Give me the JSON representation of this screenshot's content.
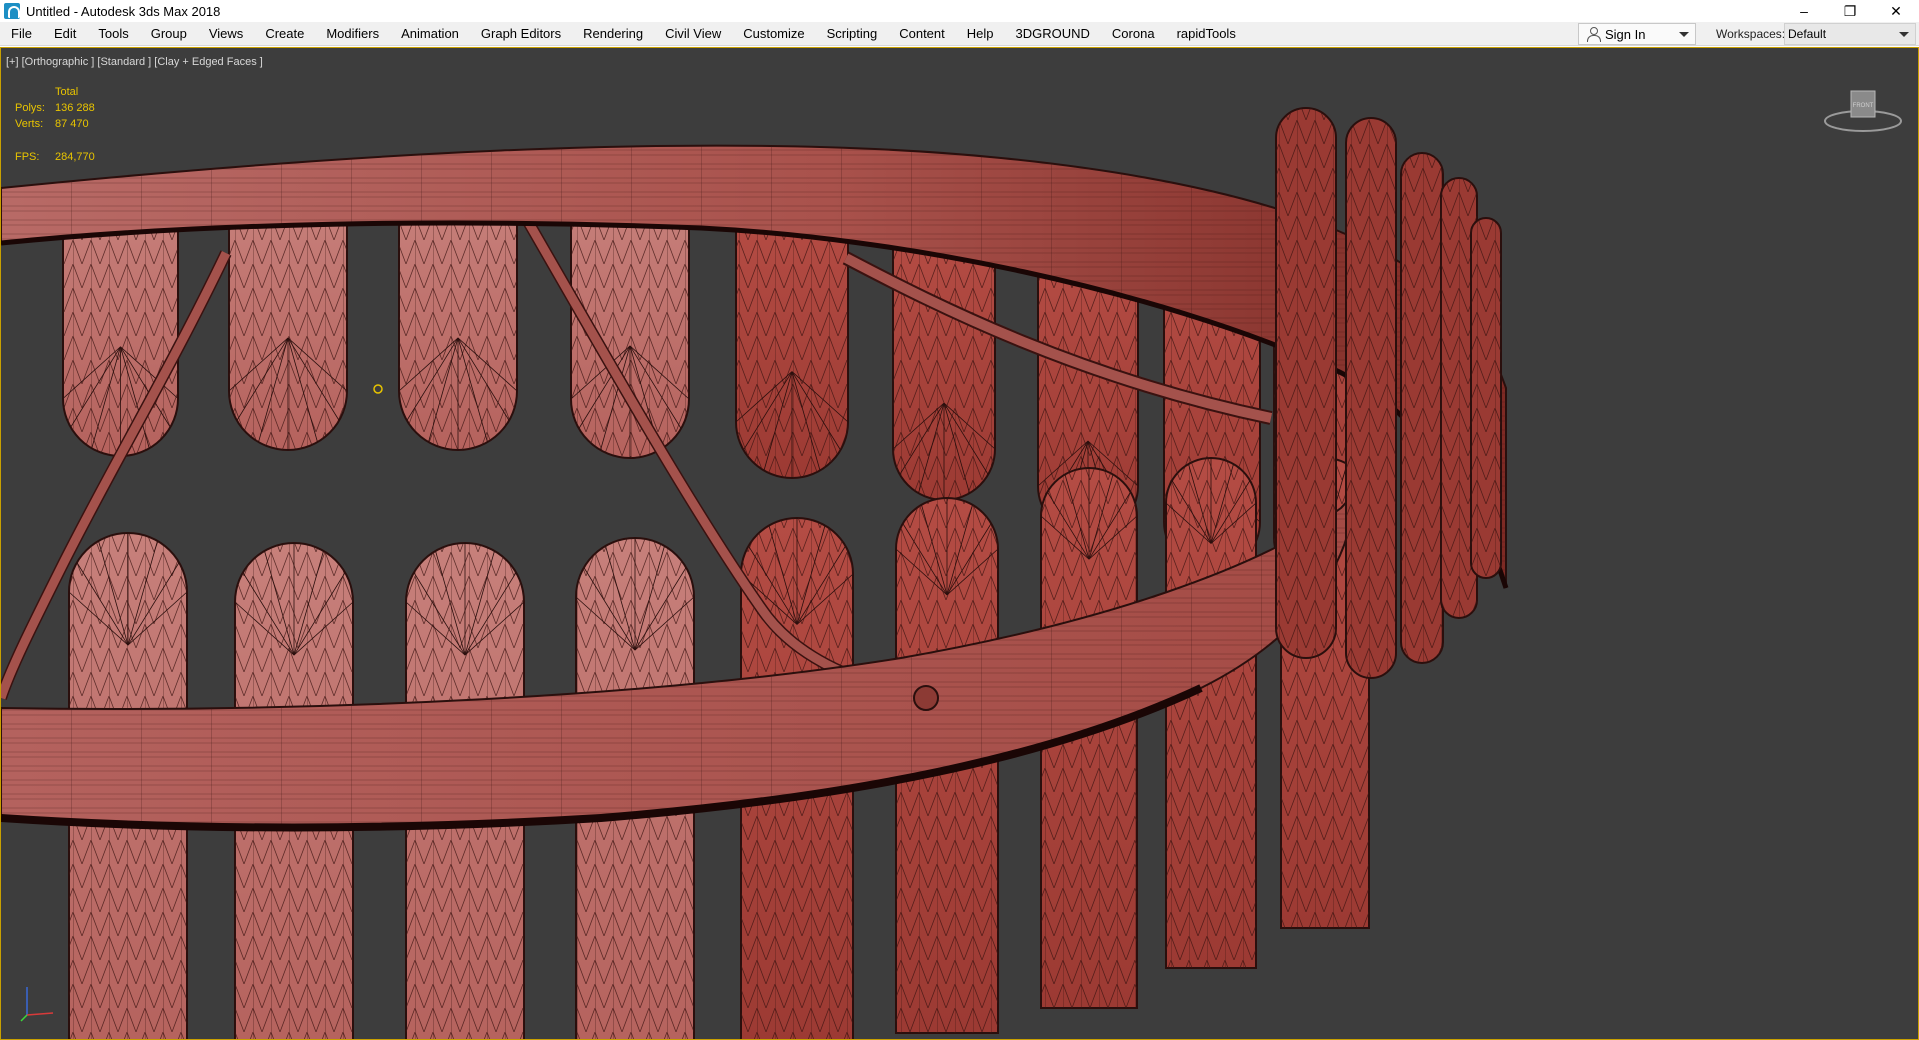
{
  "window": {
    "title": "Untitled - Autodesk 3ds Max 2018",
    "controls": {
      "minimize": "–",
      "maximize": "❐",
      "close": "✕"
    }
  },
  "menu": {
    "items": [
      "File",
      "Edit",
      "Tools",
      "Group",
      "Views",
      "Create",
      "Modifiers",
      "Animation",
      "Graph Editors",
      "Rendering",
      "Civil View",
      "Customize",
      "Scripting",
      "Content",
      "Help",
      "3DGROUND",
      "Corona",
      "rapidTools"
    ]
  },
  "account": {
    "sign_in": "Sign In"
  },
  "workspaces": {
    "label": "Workspaces:",
    "value": "Default"
  },
  "viewport": {
    "label": "[+] [Orthographic ] [Standard ] [Clay + Edged Faces ]",
    "stats": {
      "header": "Total",
      "polys_label": "Polys:",
      "polys_value": "136 288",
      "verts_label": "Verts:",
      "verts_value": "87 470",
      "fps_label": "FPS:",
      "fps_value": "284,770"
    },
    "viewcube_label": "FRONT",
    "colors": {
      "background": "#3d3d3d",
      "clay": "#b15f5a",
      "clay_light": "#c07470",
      "clay_dark": "#8c3a34",
      "edges": "#2a0f0d",
      "stats_text": "#e8c400"
    }
  }
}
